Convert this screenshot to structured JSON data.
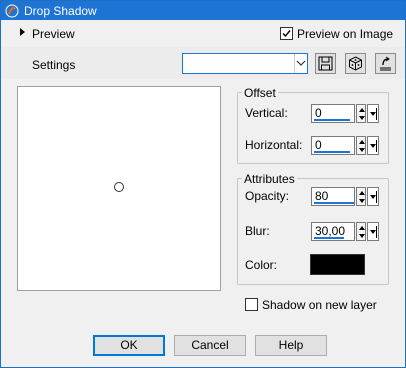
{
  "window": {
    "title": "Drop Shadow",
    "accent": "#1e74d4"
  },
  "preview": {
    "label": "Preview",
    "preview_on_image_label": "Preview on Image",
    "preview_on_image_checked": true
  },
  "settings": {
    "label": "Settings",
    "value": "",
    "icons": [
      "save-icon",
      "random-cube-icon",
      "reset-icon"
    ]
  },
  "offset": {
    "title": "Offset",
    "vertical_label": "Vertical:",
    "vertical_value": "0",
    "horizontal_label": "Horizontal:",
    "horizontal_value": "0"
  },
  "attributes": {
    "title": "Attributes",
    "opacity_label": "Opacity:",
    "opacity_value": "80",
    "blur_label": "Blur:",
    "blur_value": "30,00",
    "color_label": "Color:",
    "color_value": "#000000"
  },
  "shadow_new_layer": {
    "label": "Shadow on new layer",
    "checked": false
  },
  "buttons": {
    "ok": "OK",
    "cancel": "Cancel",
    "help": "Help"
  }
}
